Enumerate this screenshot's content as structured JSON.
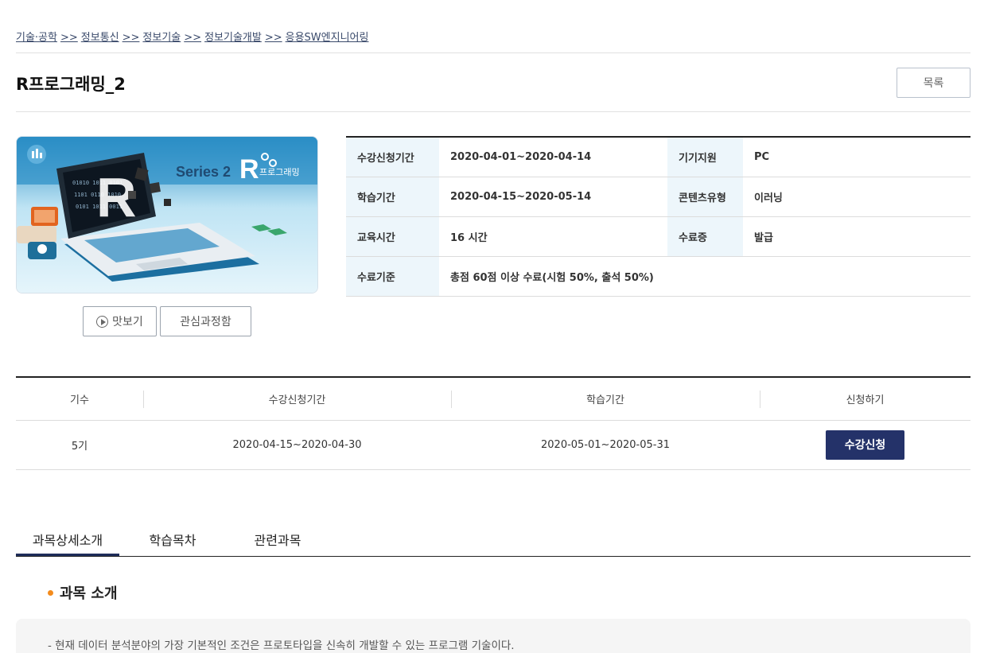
{
  "breadcrumb": [
    "기술·공학",
    "정보통신",
    "정보기술",
    "정보기술개발",
    "응용SW엔지니어링"
  ],
  "breadcrumb_separator": ">>",
  "page_title": "R프로그래밍_2",
  "list_button": "목록",
  "thumbnail": {
    "series_text": "Series 2",
    "r_text": "R",
    "subtitle": "프로그래밍"
  },
  "buttons": {
    "preview": "맛보기",
    "interest": "관심과정함"
  },
  "info": {
    "apply_period_label": "수강신청기간",
    "apply_period": "2020-04-01~2020-04-14",
    "device_label": "기기지원",
    "device": "PC",
    "study_period_label": "학습기간",
    "study_period": "2020-04-15~2020-05-14",
    "content_type_label": "콘텐츠유형",
    "content_type": "이러닝",
    "hours_label": "교육시간",
    "hours": "16 시간",
    "certificate_label": "수료증",
    "certificate": "발급",
    "criteria_label": "수료기준",
    "criteria": "총점 60점 이상 수료(시험 50%, 출석 50%)"
  },
  "sessions": {
    "headers": [
      "기수",
      "수강신청기간",
      "학습기간",
      "신청하기"
    ],
    "rows": [
      {
        "term": "5기",
        "apply_period": "2020-04-15~2020-04-30",
        "study_period": "2020-05-01~2020-05-31",
        "action": "수강신청"
      }
    ]
  },
  "tabs": [
    "과목상세소개",
    "학습목차",
    "관련과목"
  ],
  "section_title": "과목 소개",
  "description": "- 현재 데이터 분석분야의 가장 기본적인 조건은 프로토타입을 신속히 개발할 수 있는 프로그램 기술이다.",
  "colors": {
    "primary": "#243269",
    "accent": "#f38b1c",
    "info_label_bg": "#edf6fb"
  }
}
